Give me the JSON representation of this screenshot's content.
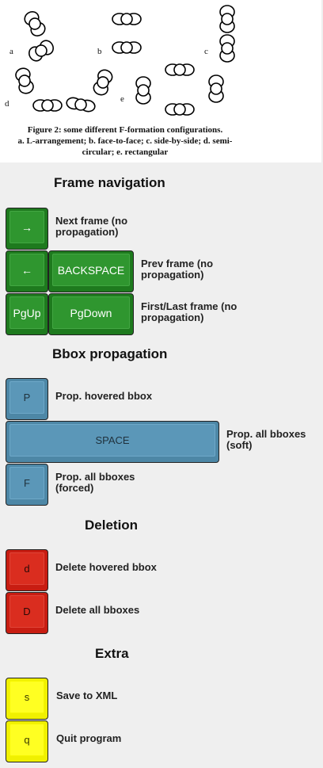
{
  "figure": {
    "panel_labels": [
      "a",
      "b",
      "c",
      "d",
      "e"
    ],
    "caption_line1": "Figure 2: some different F-formation configurations.",
    "caption_line2": "a. L-arrangement; b. face-to-face; c. side-by-side; d. semi-",
    "caption_line3": "circular; e. rectangular"
  },
  "sections": {
    "frame_navigation": {
      "title": "Frame navigation",
      "next_key": "→",
      "next_desc": "Next frame (no propagation)",
      "prev_key1": "←",
      "prev_key2": "BACKSPACE",
      "prev_desc": "Prev frame (no propagation)",
      "first_key": "PgUp",
      "last_key": "PgDown",
      "firstlast_desc": "First/Last frame (no propagation)"
    },
    "bbox_propagation": {
      "title": "Bbox propagation",
      "hovered_key": "P",
      "hovered_desc": "Prop. hovered bbox",
      "soft_key": "SPACE",
      "soft_desc": "Prop. all bboxes (soft)",
      "forced_key": "F",
      "forced_desc": "Prop. all bboxes (forced)"
    },
    "deletion": {
      "title": "Deletion",
      "delete_hovered_key": "d",
      "delete_hovered_desc": "Delete hovered bbox",
      "delete_all_key": "D",
      "delete_all_desc": "Delete all bboxes"
    },
    "extra": {
      "title": "Extra",
      "save_key": "s",
      "save_desc": "Save to XML",
      "quit_key": "q",
      "quit_desc": "Quit program"
    }
  },
  "colors": {
    "navigation": "#2f962f",
    "propagation": "#5b97b8",
    "deletion": "#da2d1f",
    "extra": "#ffff22"
  }
}
